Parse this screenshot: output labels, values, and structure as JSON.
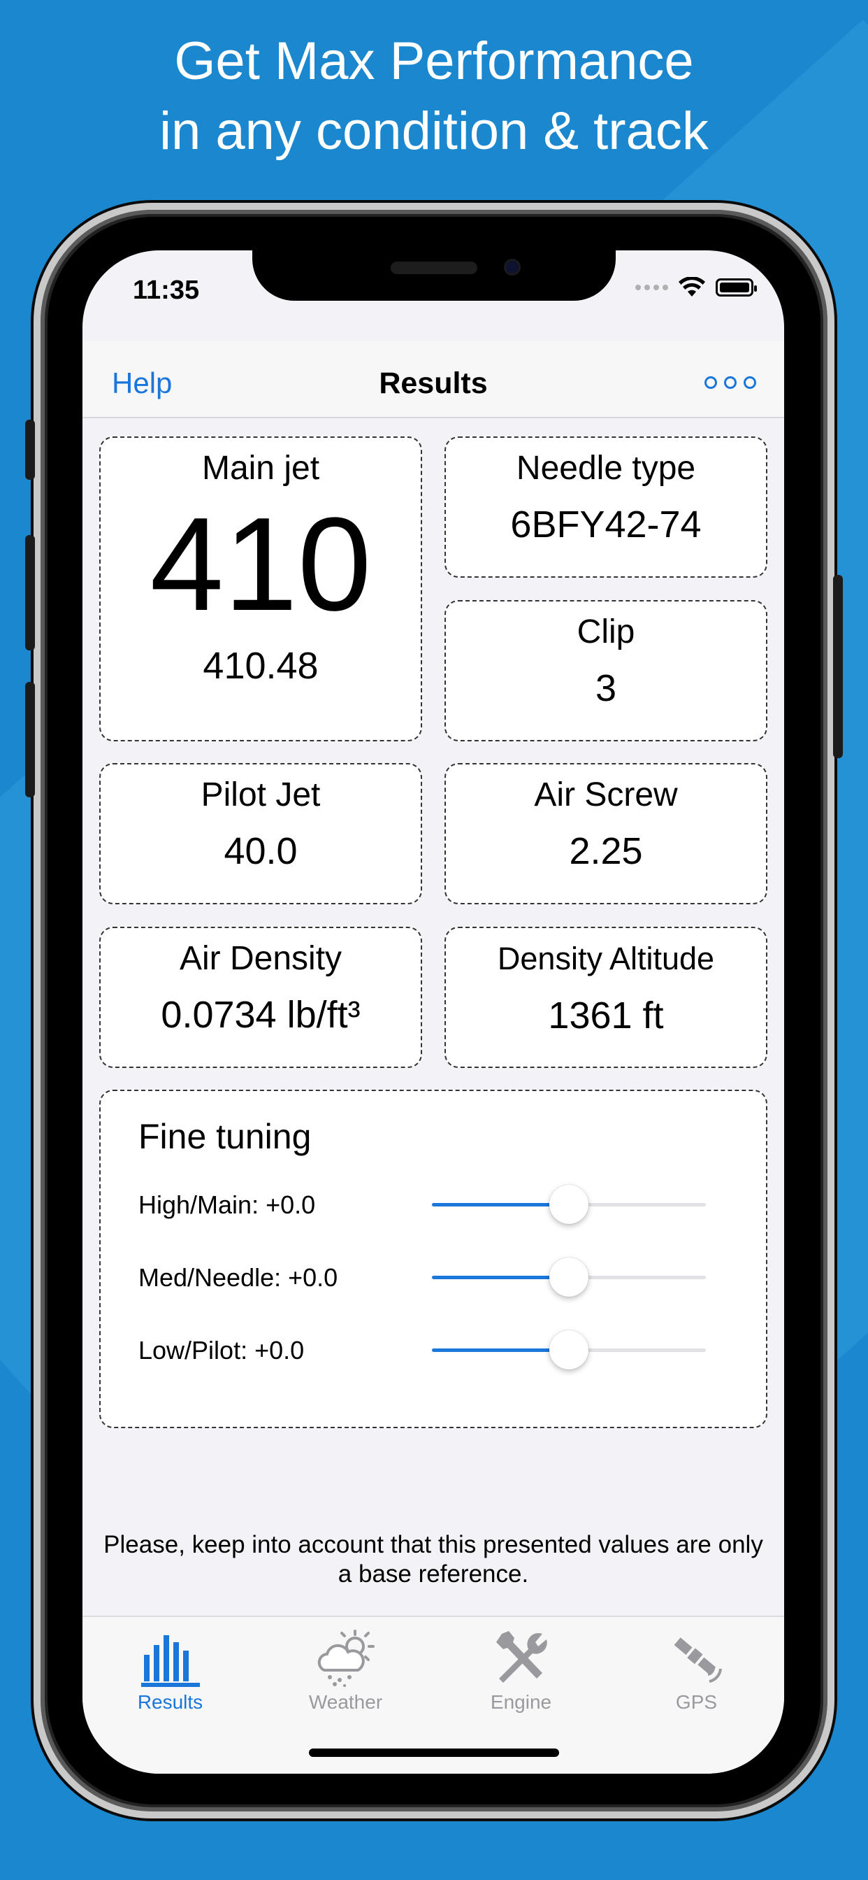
{
  "promo": {
    "headline_line1": "Get Max Performance",
    "headline_line2": "in any condition & track"
  },
  "status_bar": {
    "time": "11:35"
  },
  "nav": {
    "help_label": "Help",
    "title": "Results",
    "more_icon": "ellipsis-circle-icon"
  },
  "cards": {
    "main_jet": {
      "label": "Main jet",
      "value": "410",
      "precise": "410.48"
    },
    "needle_type": {
      "label": "Needle type",
      "value": "6BFY42-74"
    },
    "clip": {
      "label": "Clip",
      "value": "3"
    },
    "pilot_jet": {
      "label": "Pilot Jet",
      "value": "40.0"
    },
    "air_screw": {
      "label": "Air Screw",
      "value": "2.25"
    },
    "air_density": {
      "label": "Air Density",
      "value": "0.0734 lb/ft³"
    },
    "density_altitude": {
      "label": "Density Altitude",
      "value": "1361 ft"
    }
  },
  "fine_tuning": {
    "title": "Fine tuning",
    "sliders": [
      {
        "label": "High/Main: +0.0",
        "fraction": 0.5
      },
      {
        "label": "Med/Needle: +0.0",
        "fraction": 0.5
      },
      {
        "label": "Low/Pilot: +0.0",
        "fraction": 0.5
      }
    ]
  },
  "note": "Please, keep into account that this presented values are only a base reference.",
  "tabs": [
    {
      "label": "Results",
      "icon": "bar-chart-icon",
      "active": true
    },
    {
      "label": "Weather",
      "icon": "weather-icon",
      "active": false
    },
    {
      "label": "Engine",
      "icon": "tools-icon",
      "active": false
    },
    {
      "label": "GPS",
      "icon": "satellite-icon",
      "active": false
    }
  ],
  "colors": {
    "accent": "#1a76d9",
    "background": "#1a87cf",
    "inactive": "#9a9a9e"
  }
}
